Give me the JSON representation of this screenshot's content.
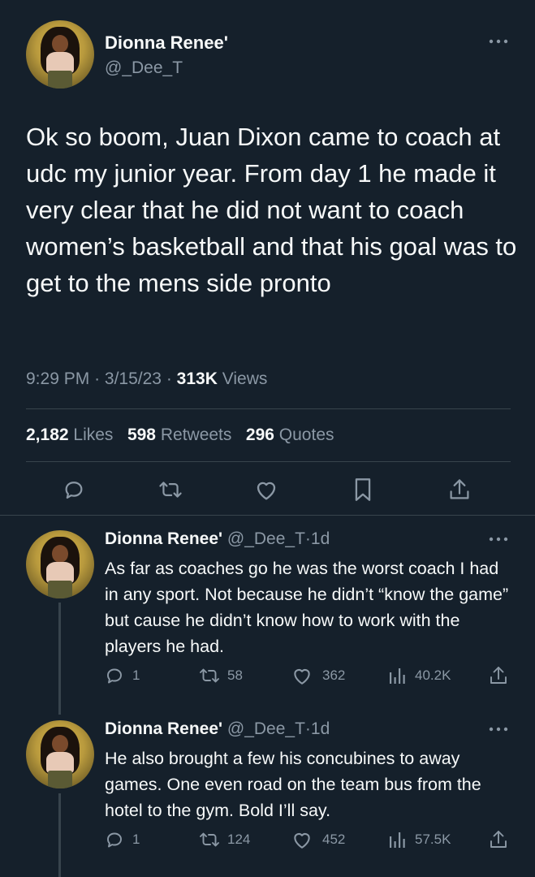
{
  "main_tweet": {
    "author_name": "Dionna Renee'",
    "author_handle": "@_Dee_T",
    "text": "Ok so boom, Juan Dixon came to coach at udc my junior year. From day 1 he made it very clear that he did not want to coach women’s basketball and that his goal was to get to the mens side pronto",
    "time": "9:29 PM",
    "date": "3/15/23",
    "views_count": "313K",
    "views_label": "Views",
    "likes_count": "2,182",
    "likes_label": "Likes",
    "retweets_count": "598",
    "retweets_label": "Retweets",
    "quotes_count": "296",
    "quotes_label": "Quotes"
  },
  "replies": [
    {
      "author_name": "Dionna Renee'",
      "author_handle": "@_Dee_T",
      "age": "1d",
      "text": "As far as coaches go he was the worst coach I had in any sport. Not because he didn’t “know the game” but cause he didn’t know how to work with the players he had.",
      "replies": "1",
      "retweets": "58",
      "likes": "362",
      "views": "40.2K"
    },
    {
      "author_name": "Dionna Renee'",
      "author_handle": "@_Dee_T",
      "age": "1d",
      "text": "He also brought a few his concubines to away games. One even road on the team bus from the hotel to the gym. Bold I’ll say.",
      "replies": "1",
      "retweets": "124",
      "likes": "452",
      "views": "57.5K"
    }
  ],
  "separator": "·",
  "colors": {
    "background": "#15202b",
    "text": "#f7f9f9",
    "muted": "#8b98a5",
    "divider": "#38444d"
  }
}
